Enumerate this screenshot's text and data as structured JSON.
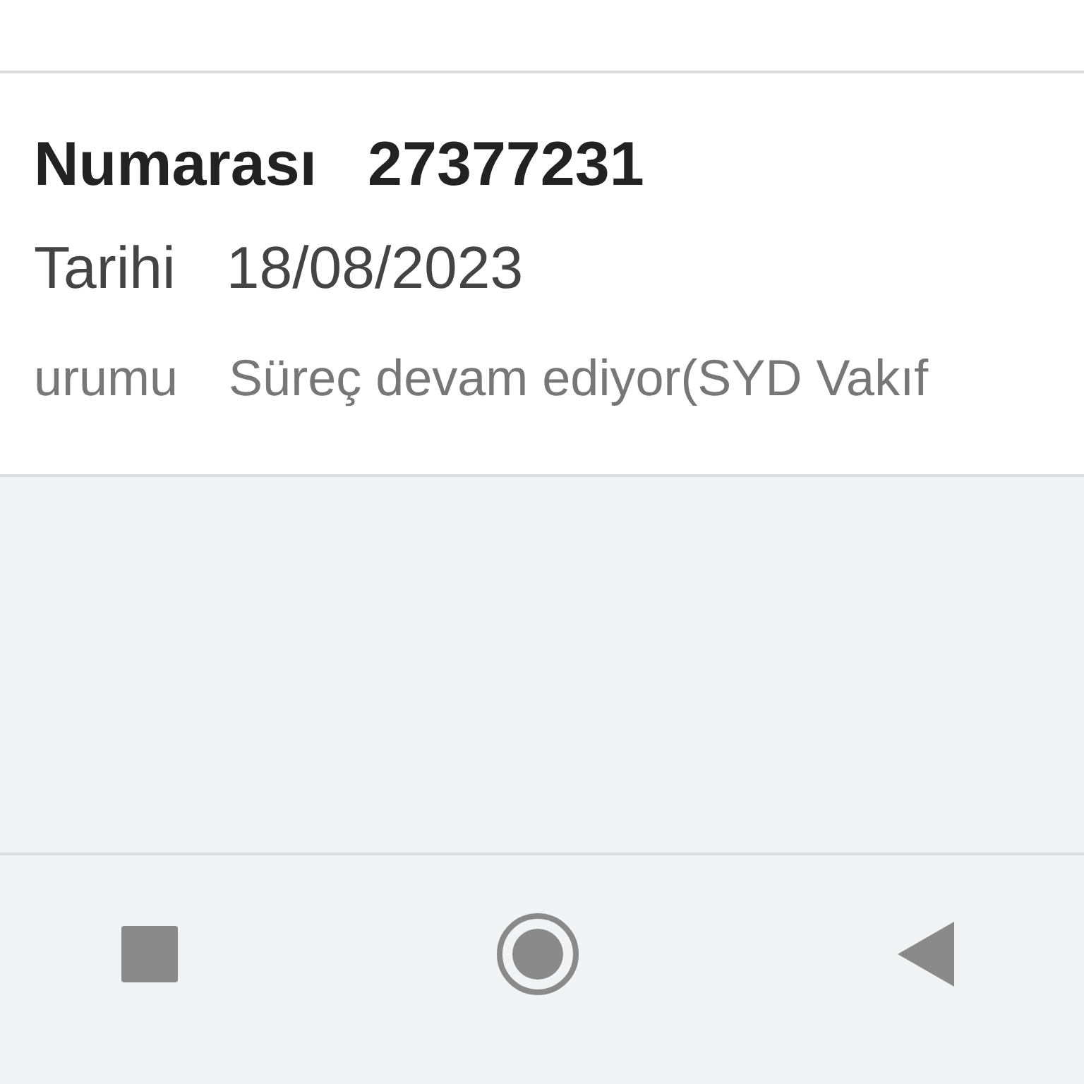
{
  "record_card": {
    "rows": [
      {
        "kind": "heading",
        "label": "Numarası",
        "value": "27377231"
      },
      {
        "kind": "date",
        "label": "Tarihi",
        "value": "18/08/2023"
      },
      {
        "kind": "status",
        "label": "urumu",
        "value": "Süreç devam ediyor(SYD Vakıf"
      }
    ]
  }
}
